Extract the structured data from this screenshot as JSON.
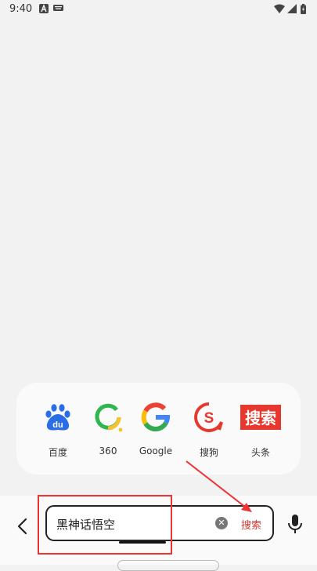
{
  "status_bar": {
    "time": "9:40"
  },
  "engines": [
    {
      "id": "baidu",
      "label": "百度",
      "icon": "baidu-icon"
    },
    {
      "id": "360",
      "label": "360",
      "icon": "360-icon"
    },
    {
      "id": "google",
      "label": "Google",
      "icon": "google-icon"
    },
    {
      "id": "sogou",
      "label": "搜狗",
      "icon": "sogou-icon"
    },
    {
      "id": "toutiao",
      "label": "头条",
      "icon": "toutiao-icon",
      "logo_text": "搜索"
    }
  ],
  "search": {
    "query": "黑神话悟空",
    "submit_label": "搜索"
  },
  "colors": {
    "accent": "#d93a36",
    "baidu_blue": "#2b6de5",
    "qihoo_green": "#2eb74c",
    "qihoo_yellow": "#f6c12e"
  }
}
